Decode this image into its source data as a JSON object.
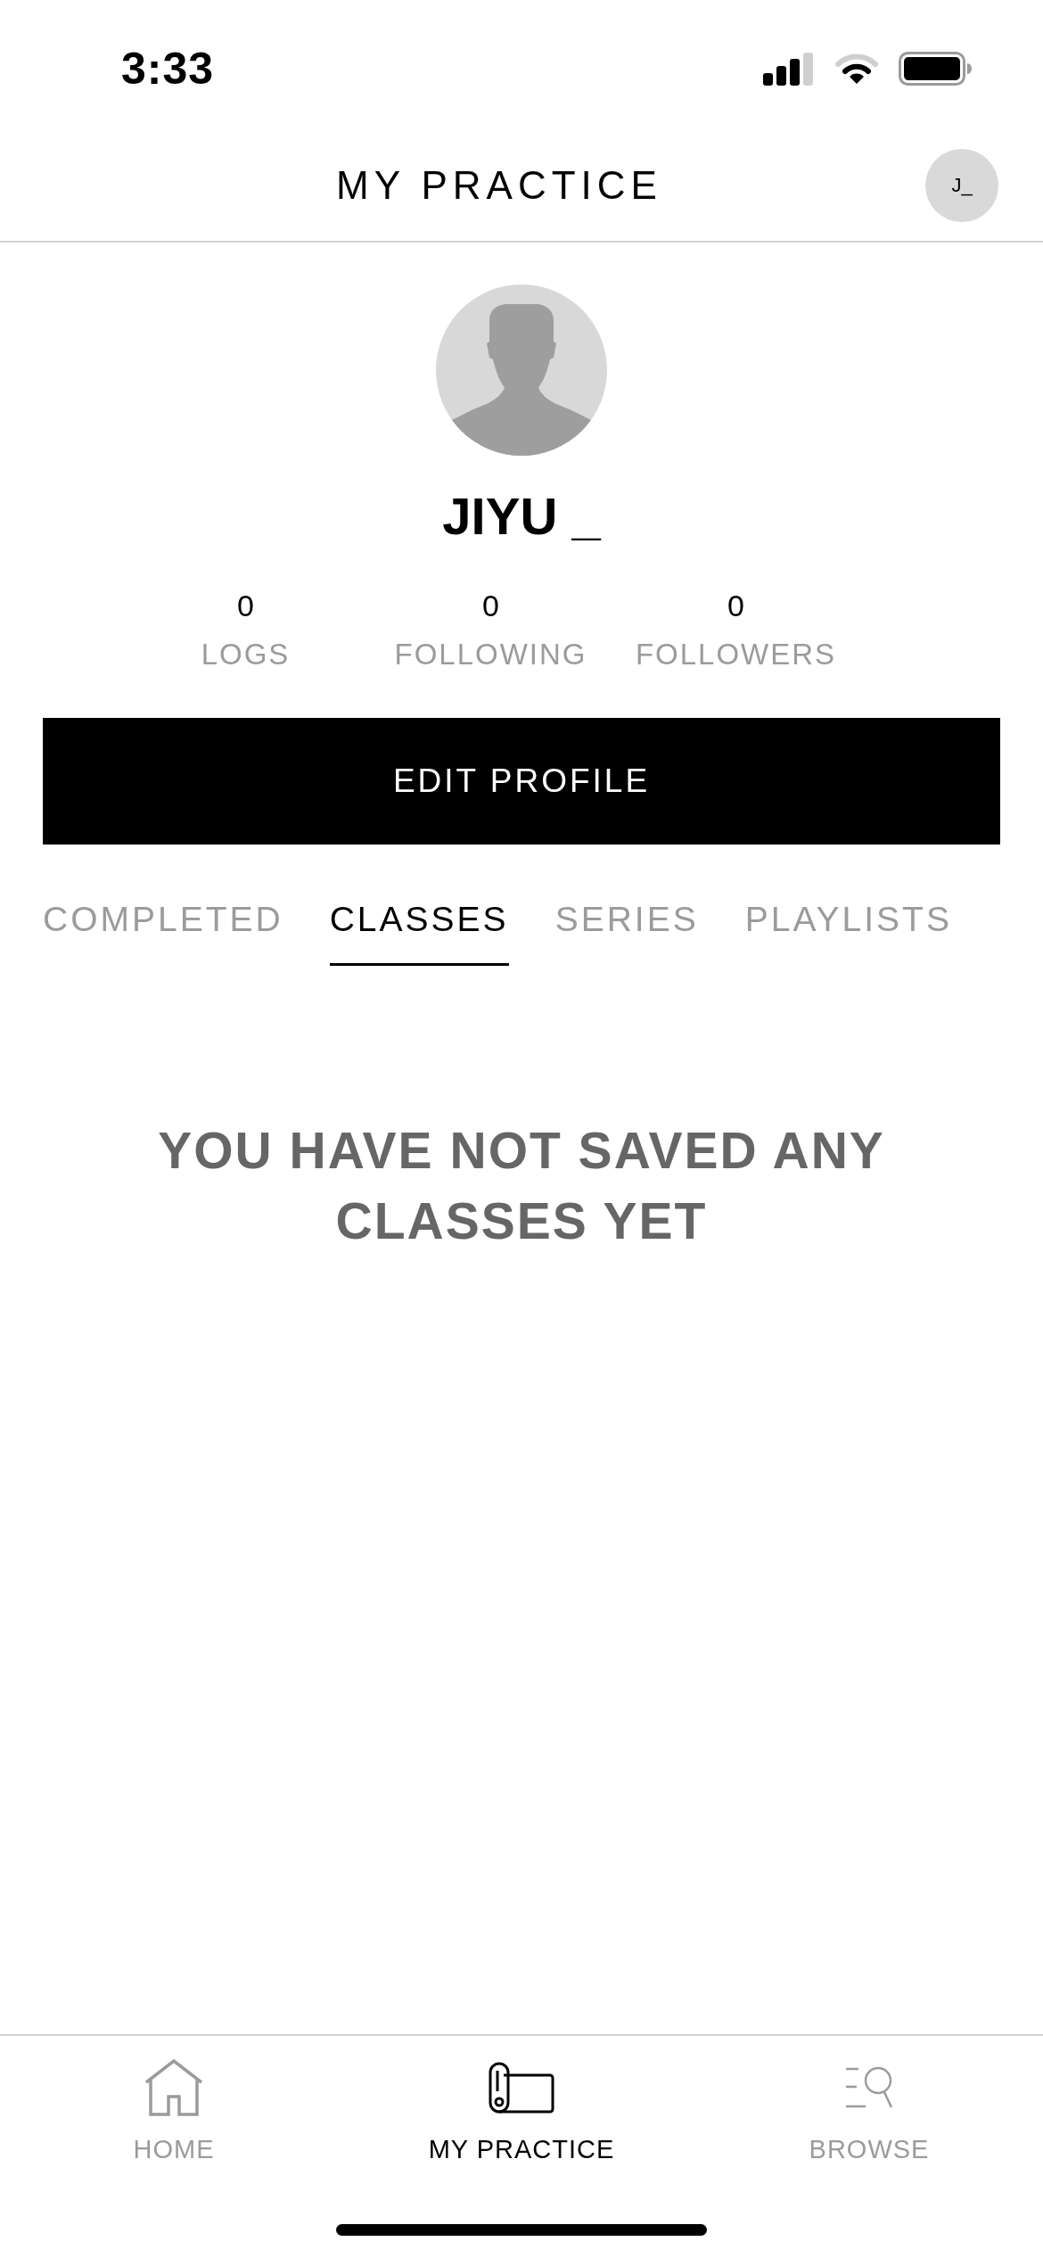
{
  "status_bar": {
    "time": "3:33"
  },
  "header": {
    "title": "MY PRACTICE",
    "avatar_initials": "J_"
  },
  "profile": {
    "name": "JIYU _",
    "stats": [
      {
        "value": "0",
        "label": "LOGS"
      },
      {
        "value": "0",
        "label": "FOLLOWING"
      },
      {
        "value": "0",
        "label": "FOLLOWERS"
      }
    ],
    "edit_button": "EDIT PROFILE"
  },
  "tabs": [
    {
      "label": "COMPLETED",
      "selected": false
    },
    {
      "label": "CLASSES",
      "selected": true
    },
    {
      "label": "SERIES",
      "selected": false
    },
    {
      "label": "PLAYLISTS",
      "selected": false
    }
  ],
  "empty_state": {
    "message": "YOU HAVE NOT SAVED ANY CLASSES YET"
  },
  "bottom_nav": [
    {
      "kind": "home",
      "label": "HOME",
      "selected": false
    },
    {
      "kind": "practice",
      "label": "MY PRACTICE",
      "selected": true
    },
    {
      "kind": "browse",
      "label": "BROWSE",
      "selected": false
    }
  ]
}
